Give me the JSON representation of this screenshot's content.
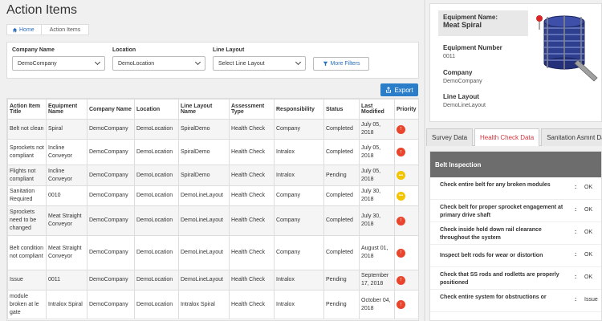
{
  "page": {
    "title": "Action Items"
  },
  "breadcrumb": {
    "home": "Home",
    "current": "Action Items"
  },
  "filters": {
    "company": {
      "label": "Company Name",
      "value": "DemoCompany"
    },
    "location": {
      "label": "Location",
      "value": "DemoLocation"
    },
    "line_layout": {
      "label": "Line Layout",
      "value": "Select Line Layout"
    },
    "more": "More Filters"
  },
  "export_label": "Export",
  "table": {
    "headers": [
      "Action Item Title",
      "Equipment Name",
      "Company Name",
      "Location",
      "Line Layout Name",
      "Assessment Type",
      "Responsibility",
      "Status",
      "Last Modified",
      "Priority"
    ],
    "rows": [
      {
        "title": "Belt not clean",
        "equipment": "Spiral",
        "company": "DemoCompany",
        "location": "DemoLocation",
        "layout": "SpiralDemo",
        "assessment": "Health Check",
        "responsibility": "Company",
        "status": "Completed",
        "modified": "July 05, 2018",
        "priority": "high",
        "priority_symbol": "↑"
      },
      {
        "title": "Sprockets not compliant",
        "equipment": "Incline Conveyor",
        "company": "DemoCompany",
        "location": "DemoLocation",
        "layout": "SpiralDemo",
        "assessment": "Health Check",
        "responsibility": "Intralox",
        "status": "Completed",
        "modified": "July 05, 2018",
        "priority": "high",
        "priority_symbol": "↑"
      },
      {
        "title": "Flights not compliant",
        "equipment": "Incline Conveyor",
        "company": "DemoCompany",
        "location": "DemoLocation",
        "layout": "SpiralDemo",
        "assessment": "Health Check",
        "responsibility": "Intralox",
        "status": "Pending",
        "modified": "July 05, 2018",
        "priority": "medium",
        "priority_symbol": "•••"
      },
      {
        "title": "Sanitation Required",
        "equipment": "0010",
        "company": "DemoCompany",
        "location": "DemoLocation",
        "layout": "DemoLineLayout",
        "assessment": "Health Check",
        "responsibility": "Company",
        "status": "Completed",
        "modified": "July 30, 2018",
        "priority": "medium",
        "priority_symbol": "•••"
      },
      {
        "title": "Sprockets need to be changed",
        "equipment": "Meat Straight Conveyor",
        "company": "DemoCompany",
        "location": "DemoLocation",
        "layout": "DemoLineLayout",
        "assessment": "Health Check",
        "responsibility": "Company",
        "status": "Completed",
        "modified": "July 30, 2018",
        "priority": "high",
        "priority_symbol": "↑"
      },
      {
        "title": "Belt condition not compliant",
        "equipment": "Meat Straight Conveyor",
        "company": "DemoCompany",
        "location": "DemoLocation",
        "layout": "DemoLineLayout",
        "assessment": "Health Check",
        "responsibility": "Company",
        "status": "Completed",
        "modified": "August 01, 2018",
        "priority": "high",
        "priority_symbol": "↑"
      },
      {
        "title": "Issue",
        "equipment": "0011",
        "company": "DemoCompany",
        "location": "DemoLocation",
        "layout": "DemoLineLayout",
        "assessment": "Health Check",
        "responsibility": "Intralox",
        "status": "Pending",
        "modified": "September 17, 2018",
        "priority": "high",
        "priority_symbol": "↑"
      },
      {
        "title": "module broken at le gate",
        "equipment": "Intralox Spiral",
        "company": "DemoCompany",
        "location": "DemoLocation",
        "layout": "Intralox Spiral",
        "assessment": "Health Check",
        "responsibility": "Intralox",
        "status": "Pending",
        "modified": "October 04, 2018",
        "priority": "high",
        "priority_symbol": "↑"
      }
    ]
  },
  "equipment": {
    "name_label": "Equipment Name:",
    "name": "Meat Spiral",
    "number_label": "Equipment Number",
    "number": "0011",
    "company_label": "Company",
    "company": "DemoCompany",
    "layout_label": "Line Layout",
    "layout": "DemoLineLayout"
  },
  "tabs": [
    "Survey Data",
    "Health Check Data",
    "Sanitation Asmnt Da"
  ],
  "health_check": {
    "section": "Belt Inspection",
    "items": [
      {
        "question": "Check entire belt for any broken modules",
        "answer": "OK"
      },
      {
        "question": "Check belt for proper sprocket engagement at primary drive shaft",
        "answer": "OK"
      },
      {
        "question": "Check inside hold down rail clearance throughout the system",
        "answer": "OK"
      },
      {
        "question": "Inspect belt rods for wear or distortion",
        "answer": "OK"
      },
      {
        "question": "Check that SS rods and rodletts are properly positioned",
        "answer": "OK"
      },
      {
        "question": "Check entire system for obstructions or",
        "answer": "Issue"
      }
    ]
  },
  "colors": {
    "accent": "#2a7dc9",
    "priority_high": "#e8452c",
    "priority_medium": "#f2c500",
    "active_tab": "#d0363e"
  }
}
